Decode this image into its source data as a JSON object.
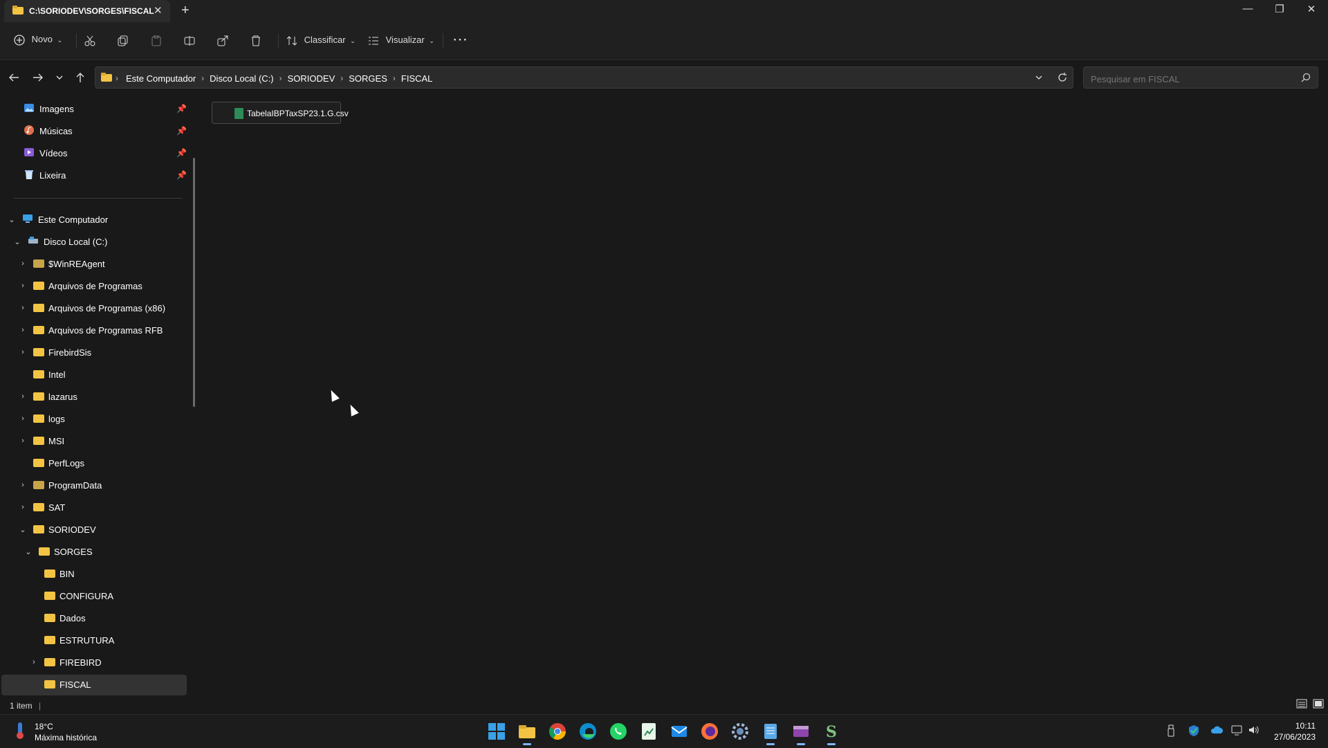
{
  "window": {
    "tab_title": "C:\\SORIODEV\\SORGES\\FISCAL",
    "new_tab": "+",
    "close_tab": "✕",
    "minimize": "—",
    "maximize": "❐",
    "close": "✕"
  },
  "toolbar": {
    "new_label": "Novo",
    "sort_label": "Classificar",
    "view_label": "Visualizar",
    "more_label": "⋯"
  },
  "address": {
    "crumbs": [
      "Este Computador",
      "Disco Local (C:)",
      "SORIODEV",
      "SORGES",
      "FISCAL"
    ]
  },
  "search": {
    "placeholder": "Pesquisar em FISCAL"
  },
  "sidebar": {
    "quick": [
      {
        "label": "Imagens"
      },
      {
        "label": "Músicas"
      },
      {
        "label": "Vídeos"
      },
      {
        "label": "Lixeira"
      }
    ],
    "computer": "Este Computador",
    "disk": "Disco Local (C:)",
    "folders": [
      "$WinREAgent",
      "Arquivos de Programas",
      "Arquivos de Programas (x86)",
      "Arquivos de Programas RFB",
      "FirebirdSis",
      "Intel",
      "lazarus",
      "logs",
      "MSI",
      "PerfLogs",
      "ProgramData",
      "SAT",
      "SORIODEV",
      "SORGES",
      "BIN",
      "CONFIGURA",
      "Dados",
      "ESTRUTURA",
      "FIREBIRD",
      "FISCAL"
    ]
  },
  "content": {
    "file_name": "TabelaIBPTaxSP23.1.G.csv"
  },
  "status": {
    "count": "1 item"
  },
  "taskbar": {
    "temp": "18°C",
    "weather_desc": "Máxima histórica",
    "time": "10:11",
    "date": "27/06/2023"
  },
  "colors": {
    "folder": "#f3c443",
    "accent": "#7fb8ff",
    "background": "#191919"
  }
}
